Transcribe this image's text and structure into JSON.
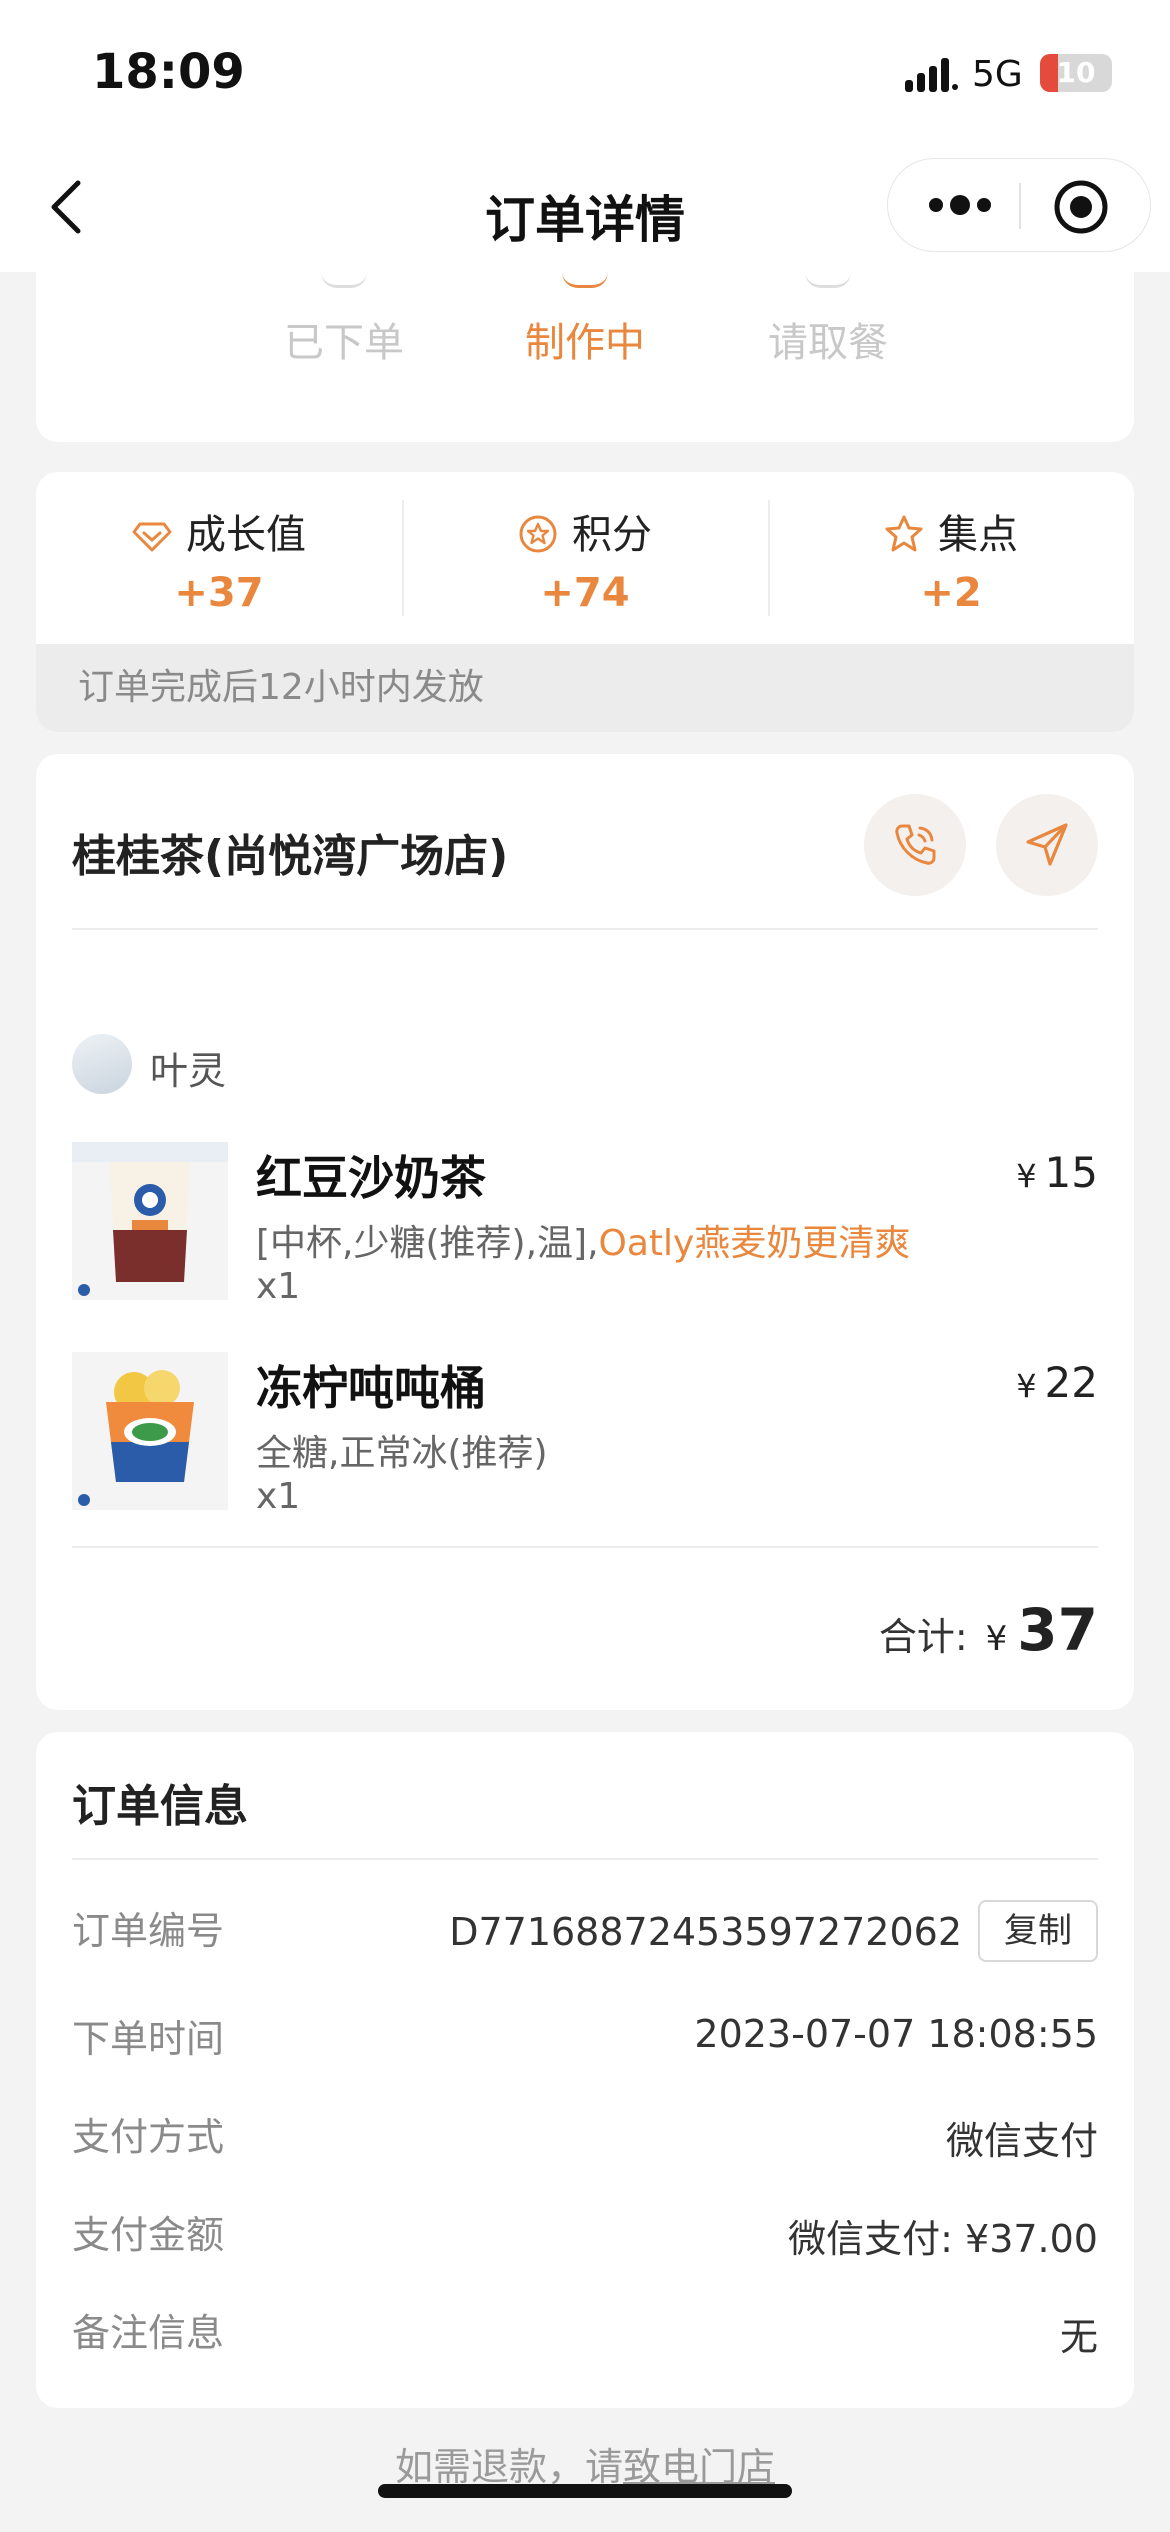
{
  "status_bar": {
    "time": "18:09",
    "network": "5G",
    "battery": "10"
  },
  "nav": {
    "title": "订单详情"
  },
  "progress": {
    "steps": [
      "已下单",
      "制作中",
      "请取餐"
    ]
  },
  "rewards": {
    "items": [
      {
        "label": "成长值",
        "value": "+37",
        "icon": "diamond-icon"
      },
      {
        "label": "积分",
        "value": "+74",
        "icon": "coin-star-icon"
      },
      {
        "label": "集点",
        "value": "+2",
        "icon": "star-icon"
      }
    ],
    "note": "订单完成后12小时内发放",
    "accent_color": "#e8873d"
  },
  "order": {
    "store_name": "桂桂茶(尚悦湾广场店)",
    "customer_name": "叶灵",
    "items": [
      {
        "name": "红豆沙奶茶",
        "spec": "[中杯,少糖(推荐),温],",
        "spec_highlight": "Oatly燕麦奶更清爽",
        "qty": "x1",
        "currency": "¥",
        "price": "15"
      },
      {
        "name": "冻柠吨吨桶",
        "spec": "全糖,正常冰(推荐)",
        "spec_highlight": "",
        "qty": "x1",
        "currency": "¥",
        "price": "22"
      }
    ],
    "total_label": "合计:",
    "total_currency": "¥",
    "total_amount": "37"
  },
  "info": {
    "title": "订单信息",
    "rows": [
      {
        "key": "订单编号",
        "value": "D77168872453597272062"
      },
      {
        "key": "下单时间",
        "value": "2023-07-07 18:08:55"
      },
      {
        "key": "支付方式",
        "value": "微信支付"
      },
      {
        "key": "支付金额",
        "value": "微信支付: ¥37.00"
      },
      {
        "key": "备注信息",
        "value": "无"
      }
    ],
    "copy_label": "复制"
  },
  "footer": {
    "note_prefix": "如需退款，请",
    "note_link": "致电门店"
  }
}
